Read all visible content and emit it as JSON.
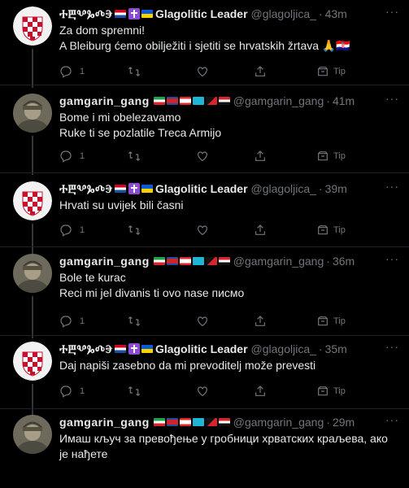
{
  "tweets": [
    {
      "author_glyphs": "ⰀⰁⰂⰃⰄⰅ",
      "display_name": "Glagolitic Leader",
      "handle": "@glagoljica_",
      "time": "43m",
      "lines": [
        "Za dom spremni!",
        "A Bleiburg ćemo obilježiti i sjetiti se hrvatskih žrtava 🙏🇭🇷"
      ],
      "reply_count": "1",
      "tip_label": "Tip",
      "avatar": "croatian-checkerboard"
    },
    {
      "author_glyphs": "gamgarin_gang",
      "display_name": "",
      "handle": "@gamgarin_gang",
      "time": "41m",
      "lines": [
        "Bome i mi obelezavamo",
        "Ruke ti se pozlatile Treca Armijo"
      ],
      "reply_count": "1",
      "tip_label": "Tip",
      "avatar": "soldier-photo"
    },
    {
      "author_glyphs": "ⰀⰁⰂⰃⰄⰅ",
      "display_name": "Glagolitic Leader",
      "handle": "@glagoljica_",
      "time": "39m",
      "lines": [
        "Hrvati su uvijek bili časni"
      ],
      "reply_count": "1",
      "tip_label": "Tip",
      "avatar": "croatian-checkerboard"
    },
    {
      "author_glyphs": "gamgarin_gang",
      "display_name": "",
      "handle": "@gamgarin_gang",
      "time": "36m",
      "lines": [
        "Bole te kurac",
        "Reci mi jel divanis ti ovo nase писмо"
      ],
      "reply_count": "1",
      "tip_label": "Tip",
      "avatar": "soldier-photo"
    },
    {
      "author_glyphs": "ⰀⰁⰂⰃⰄⰅ",
      "display_name": "Glagolitic Leader",
      "handle": "@glagoljica_",
      "time": "35m",
      "lines": [
        "Daj napiši zasebno da mi prevoditelj može prevesti"
      ],
      "reply_count": "1",
      "tip_label": "Tip",
      "avatar": "croatian-checkerboard"
    },
    {
      "author_glyphs": "gamgarin_gang",
      "display_name": "",
      "handle": "@gamgarin_gang",
      "time": "29m",
      "lines": [
        "Имаш кључ за превођење у гробници хрватских краљева, ако",
        "је нађете"
      ],
      "reply_count": "",
      "tip_label": "",
      "avatar": "soldier-photo"
    }
  ],
  "colors": {
    "background": "#000000",
    "text": "#e7e9ea",
    "muted": "#71767b",
    "thread_line": "#333639"
  }
}
